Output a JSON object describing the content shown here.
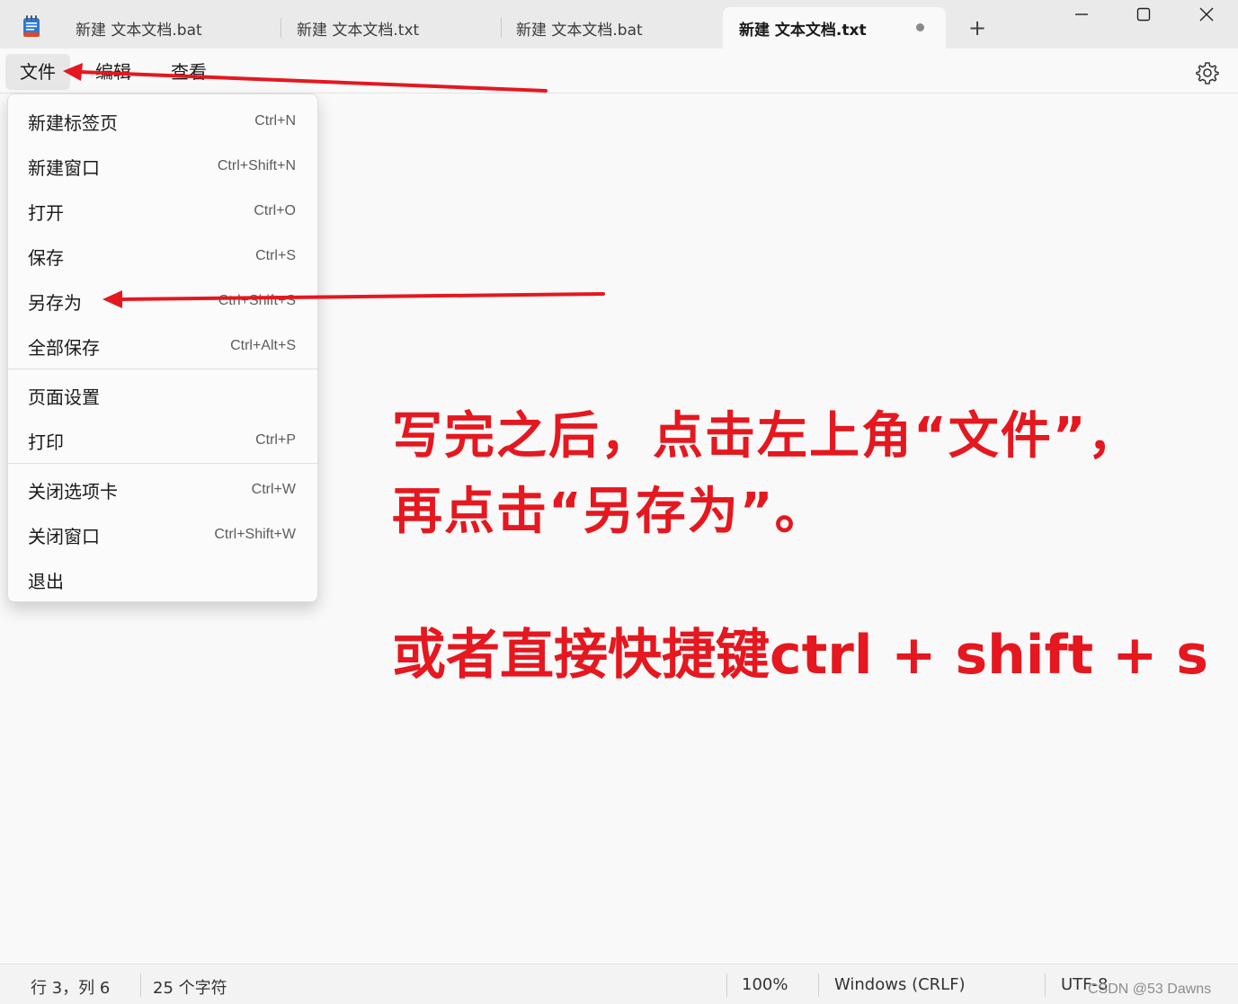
{
  "tabs": [
    {
      "label": "新建 文本文档.bat"
    },
    {
      "label": "新建 文本文档.txt"
    },
    {
      "label": "新建 文本文档.bat"
    },
    {
      "label": "新建 文本文档.txt",
      "active": true,
      "unsaved": true
    }
  ],
  "new_tab_label": "+",
  "menubar": {
    "file": "文件",
    "edit": "编辑",
    "view": "查看"
  },
  "file_menu": [
    {
      "label": "新建标签页",
      "shortcut": "Ctrl+N"
    },
    {
      "label": "新建窗口",
      "shortcut": "Ctrl+Shift+N"
    },
    {
      "label": "打开",
      "shortcut": "Ctrl+O"
    },
    {
      "label": "保存",
      "shortcut": "Ctrl+S"
    },
    {
      "label": "另存为",
      "shortcut": "Ctrl+Shift+S"
    },
    {
      "label": "全部保存",
      "shortcut": "Ctrl+Alt+S"
    },
    {
      "label": "页面设置",
      "shortcut": ""
    },
    {
      "label": "打印",
      "shortcut": "Ctrl+P"
    },
    {
      "label": "关闭选项卡",
      "shortcut": "Ctrl+W"
    },
    {
      "label": "关闭窗口",
      "shortcut": "Ctrl+Shift+W"
    },
    {
      "label": "退出",
      "shortcut": ""
    }
  ],
  "annotation": {
    "line1": "写完之后，点击左上角“文件”，",
    "line2": "再点击“另存为”。",
    "line3": "或者直接快捷键ctrl + shift + s",
    "color": "#e5171f"
  },
  "statusbar": {
    "position": "行 3，列 6",
    "char_count": "25 个字符",
    "zoom": "100%",
    "line_ending": "Windows (CRLF)",
    "encoding": "UTF-8"
  },
  "watermark": "CSDN @53    Dawns"
}
